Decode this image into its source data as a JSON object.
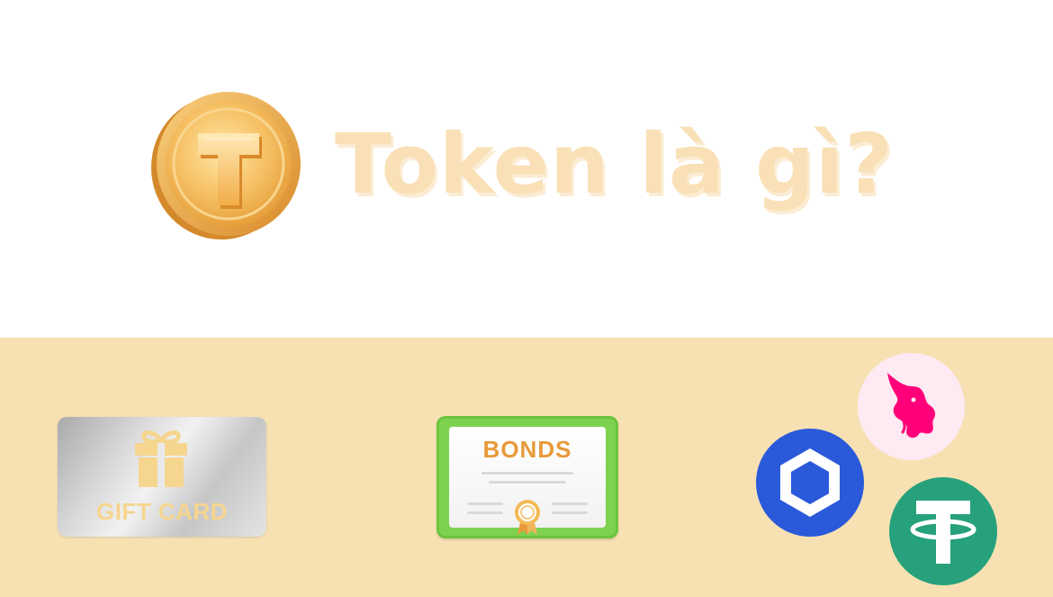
{
  "header": {
    "title": "Token là gì?",
    "coin_icon": "gold-coin-t-icon"
  },
  "cards": {
    "gift_card": {
      "label": "GIFT CARD",
      "icon": "gift-box-icon"
    },
    "bonds": {
      "label": "BONDS",
      "icon": "certificate-seal-icon"
    }
  },
  "logos": {
    "uniswap": {
      "icon": "uniswap-unicorn-icon",
      "color": "#ff007a"
    },
    "chainlink": {
      "icon": "chainlink-hexagon-icon",
      "color": "#2a5ad9"
    },
    "tether": {
      "icon": "tether-t-icon",
      "color": "#26a17b"
    }
  },
  "colors": {
    "band": "#f7e1b3",
    "title": "#f9e0b6",
    "gold": "#f0b84a"
  }
}
